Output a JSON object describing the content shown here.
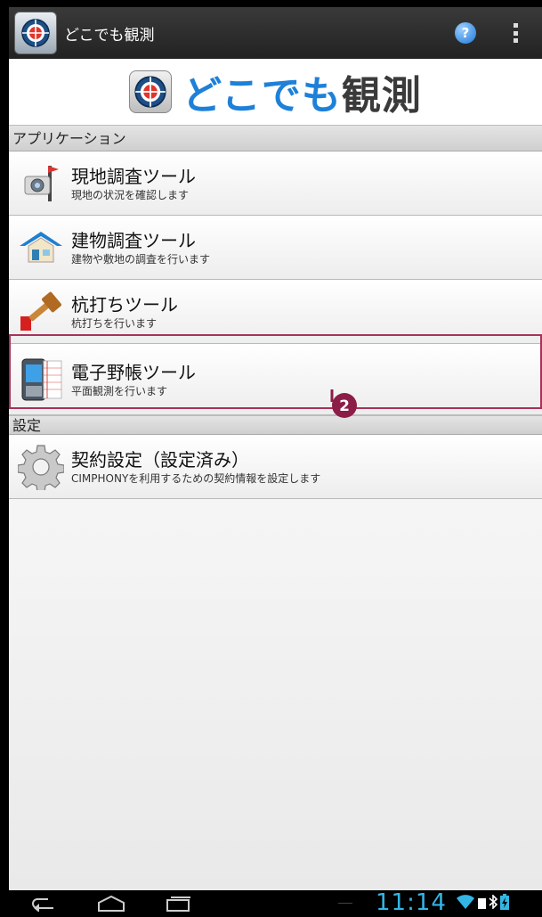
{
  "actionbar": {
    "title": "どこでも観測",
    "help_glyph": "?"
  },
  "banner": {
    "title_part1": "どこでも",
    "title_part2": "観測"
  },
  "sections": [
    {
      "header": "アプリケーション",
      "items": [
        {
          "title": "現地調査ツール",
          "subtitle": "現地の状況を確認します",
          "icon": "camera-pin-icon"
        },
        {
          "title": "建物調査ツール",
          "subtitle": "建物や敷地の調査を行います",
          "icon": "house-icon"
        },
        {
          "title": "杭打ちツール",
          "subtitle": "杭打ちを行います",
          "icon": "hammer-icon"
        },
        {
          "title": "電子野帳ツール",
          "subtitle": "平面観測を行います",
          "icon": "field-notebook-device-icon"
        }
      ]
    },
    {
      "header": "設定",
      "items": [
        {
          "title": "契約設定（設定済み）",
          "subtitle": "CIMPHONYを利用するための契約情報を設定します",
          "icon": "gear-icon"
        }
      ]
    }
  ],
  "annotation": {
    "step_number": "2"
  },
  "statusbar": {
    "time": "11:14"
  },
  "colors": {
    "accent": "#1e80d8",
    "highlight": "#a8315a",
    "clock": "#33b5e5"
  }
}
